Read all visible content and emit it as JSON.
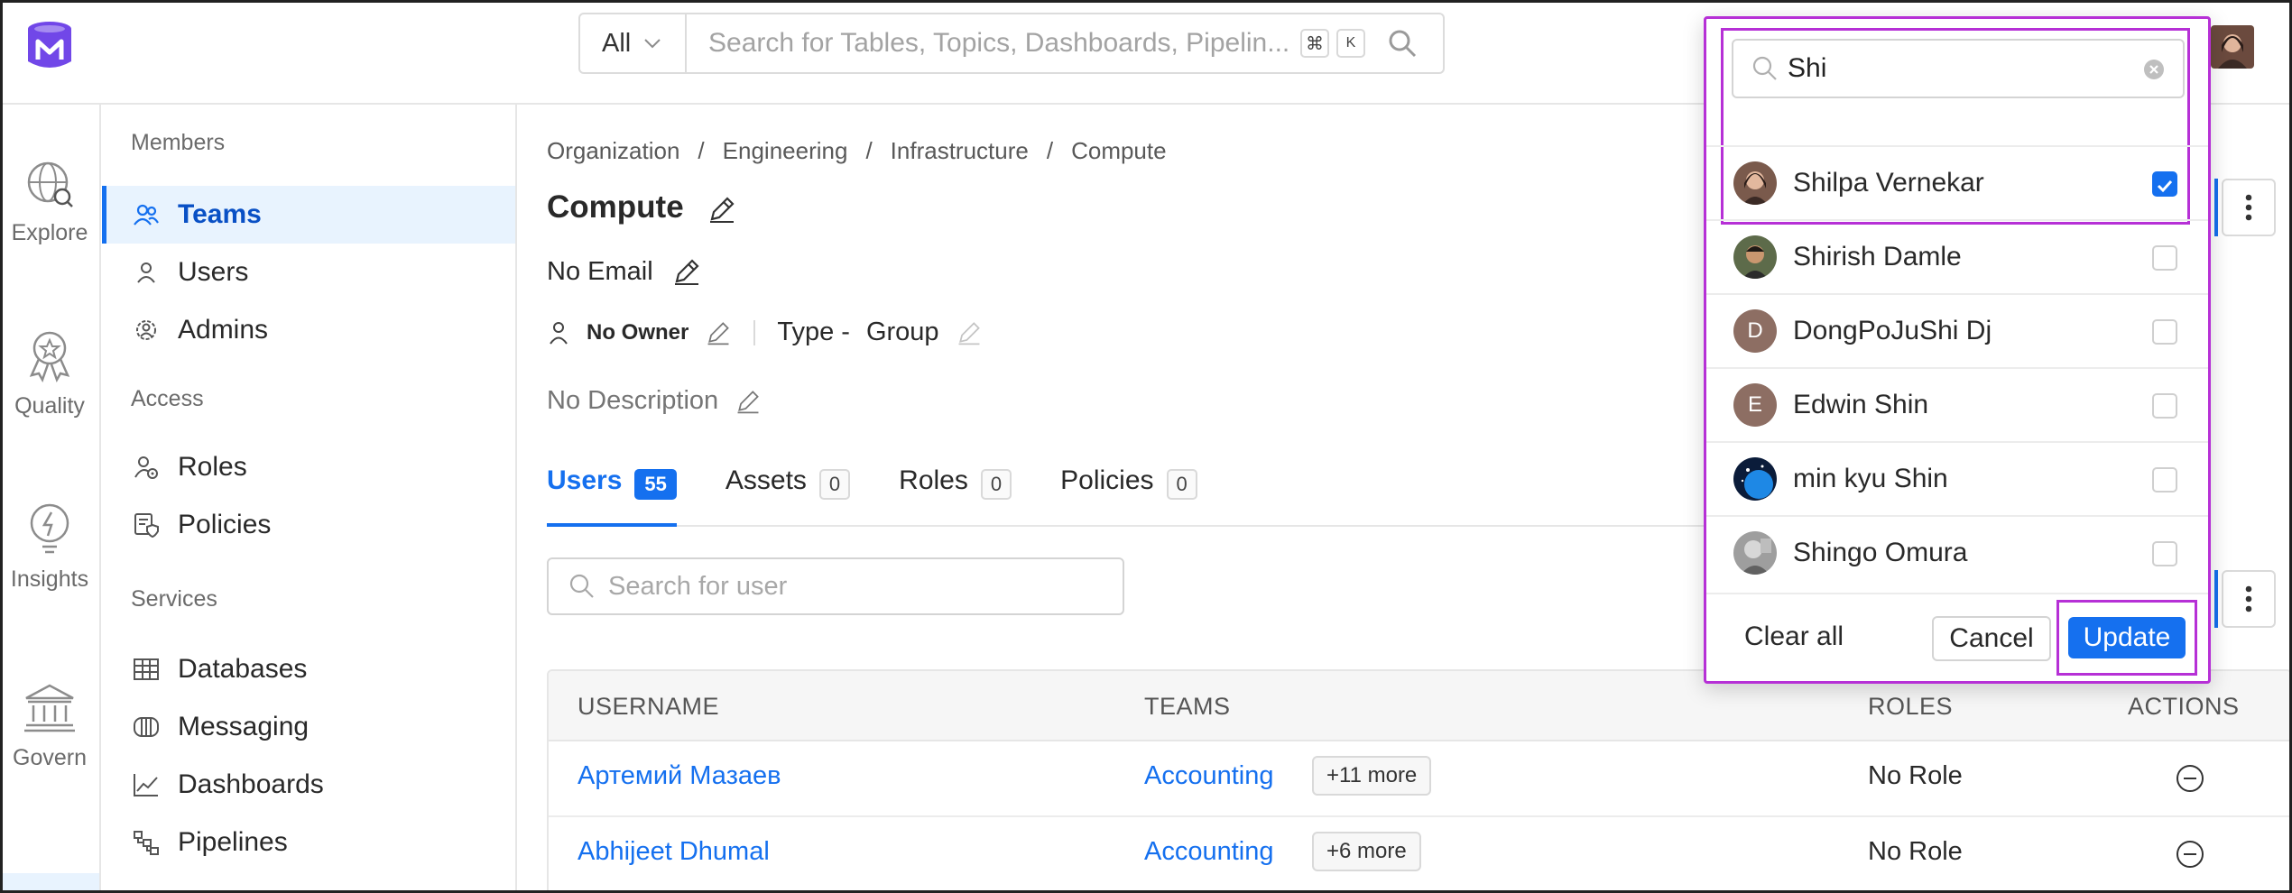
{
  "header": {
    "search_scope": "All",
    "search_placeholder": "Search for Tables, Topics, Dashboards, Pipelin...",
    "shortcut_keys": [
      "⌘",
      "K"
    ]
  },
  "rail": {
    "items": [
      {
        "label": "Explore",
        "icon": "globe-search-icon"
      },
      {
        "label": "Quality",
        "icon": "award-badge-icon"
      },
      {
        "label": "Insights",
        "icon": "lightbulb-icon"
      },
      {
        "label": "Govern",
        "icon": "bank-building-icon"
      }
    ]
  },
  "sidebar": {
    "sections": [
      {
        "title": "Members",
        "items": [
          {
            "label": "Teams",
            "icon": "teams-icon",
            "active": true
          },
          {
            "label": "Users",
            "icon": "user-icon"
          },
          {
            "label": "Admins",
            "icon": "admin-gear-icon"
          }
        ]
      },
      {
        "title": "Access",
        "items": [
          {
            "label": "Roles",
            "icon": "roles-icon"
          },
          {
            "label": "Policies",
            "icon": "policy-shield-icon"
          }
        ]
      },
      {
        "title": "Services",
        "items": [
          {
            "label": "Databases",
            "icon": "database-icon"
          },
          {
            "label": "Messaging",
            "icon": "messaging-icon"
          },
          {
            "label": "Dashboards",
            "icon": "chart-line-icon"
          },
          {
            "label": "Pipelines",
            "icon": "pipeline-icon"
          }
        ]
      }
    ]
  },
  "main": {
    "breadcrumb": [
      "Organization",
      "Engineering",
      "Infrastructure",
      "Compute"
    ],
    "title": "Compute",
    "email": "No Email",
    "owner": "No Owner",
    "type_label": "Type -",
    "type_value": "Group",
    "description": "No Description",
    "tabs": [
      {
        "label": "Users",
        "count": "55",
        "active": true
      },
      {
        "label": "Assets",
        "count": "0"
      },
      {
        "label": "Roles",
        "count": "0"
      },
      {
        "label": "Policies",
        "count": "0"
      }
    ],
    "user_search_placeholder": "Search for user",
    "table": {
      "columns": [
        "USERNAME",
        "TEAMS",
        "ROLES",
        "ACTIONS"
      ],
      "rows": [
        {
          "username": "Артемий Мазаев",
          "team": "Accounting",
          "more": "+11 more",
          "role": "No Role"
        },
        {
          "username": "Abhijeet Dhumal",
          "team": "Accounting",
          "more": "+6 more",
          "role": "No Role"
        }
      ]
    }
  },
  "popover": {
    "search_value": "Shi",
    "options": [
      {
        "name": "Shilpa Vernekar",
        "avatar": "photo",
        "checked": true
      },
      {
        "name": "Shirish Damle",
        "avatar": "photo",
        "checked": false
      },
      {
        "name": "DongPoJuShi Dj",
        "avatar": "D",
        "avatar_color": "#8d6e63",
        "checked": false
      },
      {
        "name": "Edwin Shin",
        "avatar": "E",
        "avatar_color": "#8d6e63",
        "checked": false
      },
      {
        "name": "min kyu Shin",
        "avatar": "photo",
        "checked": false
      },
      {
        "name": "Shingo Omura",
        "avatar": "photo",
        "checked": false
      }
    ],
    "clear_all": "Clear all",
    "cancel": "Cancel",
    "update": "Update"
  },
  "colors": {
    "accent": "#1570ef",
    "highlight": "#b630d6",
    "active_bg": "#e8f3fe"
  }
}
